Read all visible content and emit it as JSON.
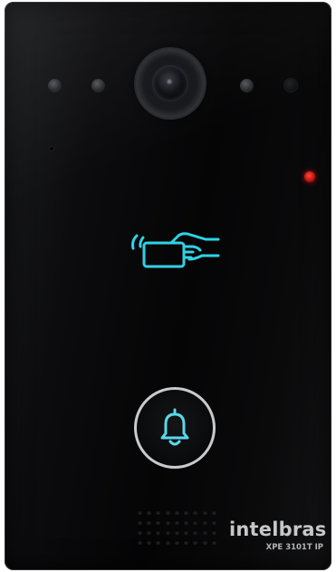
{
  "device": {
    "brand": "intelbras",
    "model": "XPE 3101T IP"
  },
  "indicators": {
    "status_led_color": "#d0190f",
    "rfid_icon": "rfid-card-hand-icon",
    "rfid_icon_color": "#2fd2e6",
    "bell_icon": "bell-icon",
    "bell_icon_color": "#58d9ec",
    "bell_ring_color": "#c9cacc"
  }
}
